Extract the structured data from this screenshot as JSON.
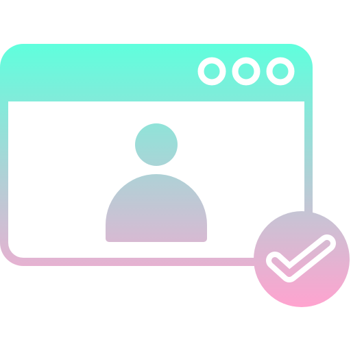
{
  "icon": {
    "name": "verified-user-profile-window-icon",
    "colors": {
      "gradient_top": "#5FFFDD",
      "gradient_bottom": "#FFA3CF",
      "background": "#FFFFFF"
    },
    "parts": {
      "window": "browser-window-icon",
      "window_buttons": [
        "window-button-icon",
        "window-button-icon",
        "window-button-icon"
      ],
      "avatar": "user-avatar-icon",
      "badge": "checkmark-badge-icon"
    }
  }
}
